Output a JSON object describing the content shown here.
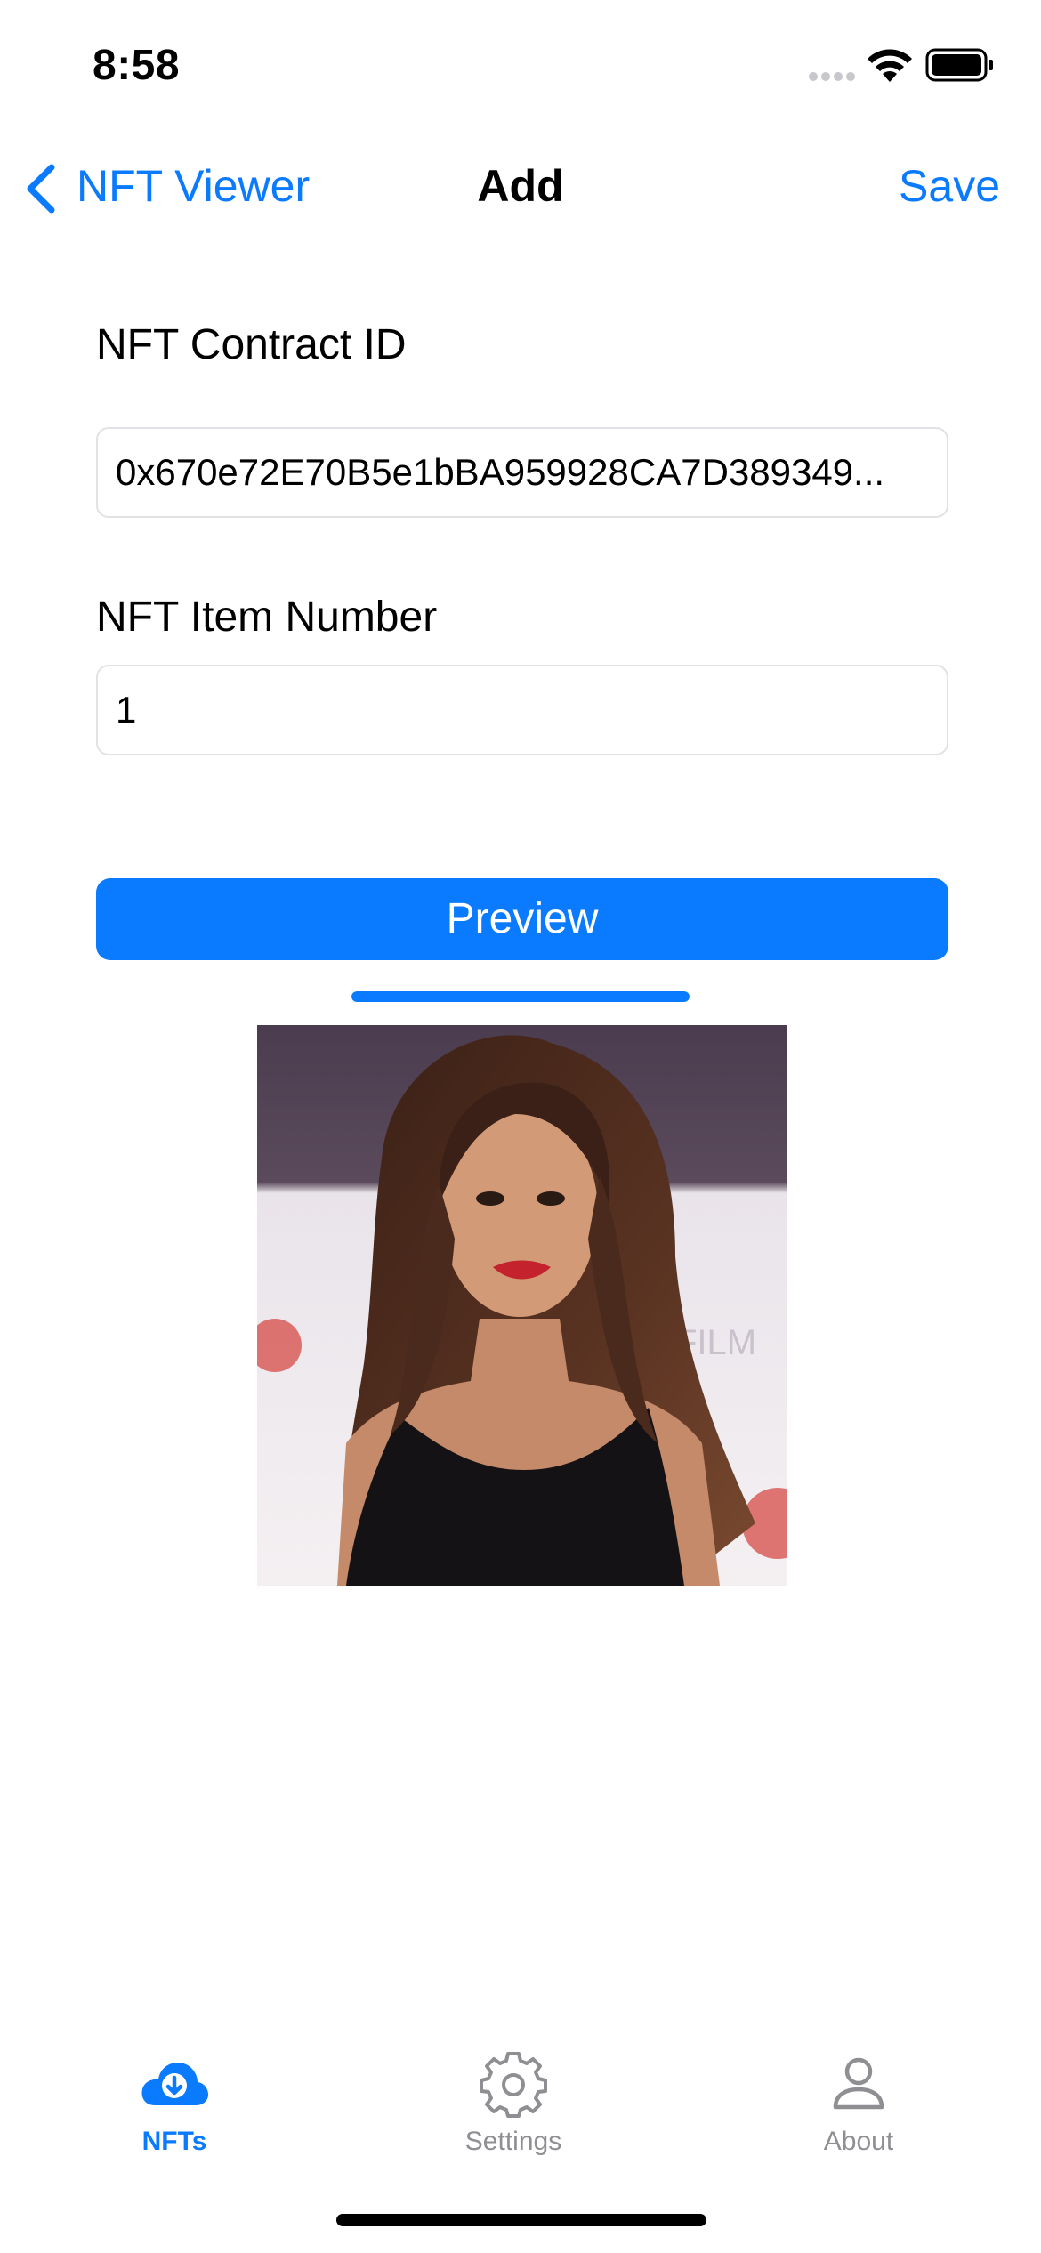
{
  "status_bar": {
    "time": "8:58"
  },
  "nav": {
    "back_label": "NFT Viewer",
    "title": "Add",
    "save_label": "Save"
  },
  "form": {
    "contract_label": "NFT Contract ID",
    "contract_value": "0x670e72E70B5e1bBA959928CA7D389349...",
    "item_label": "NFT Item Number",
    "item_value": "1",
    "preview_label": "Preview",
    "progress": 1.0
  },
  "tabs": [
    {
      "label": "NFTs",
      "icon": "cloud-download-icon",
      "active": true
    },
    {
      "label": "Settings",
      "icon": "gear-icon",
      "active": false
    },
    {
      "label": "About",
      "icon": "person-icon",
      "active": false
    }
  ],
  "colors": {
    "accent": "#0a7aff",
    "inactive": "#8e8e93"
  }
}
